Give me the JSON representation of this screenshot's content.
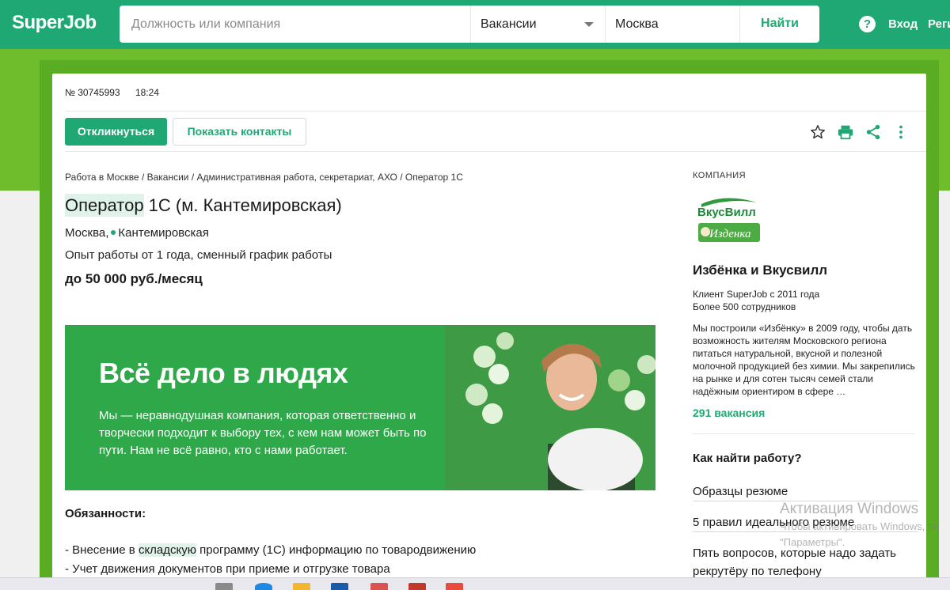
{
  "header": {
    "logo": "SuperJob",
    "search_placeholder": "Должность или компания",
    "type_select": "Вакансии",
    "city": "Москва",
    "find_button": "Найти",
    "help_icon": "question-circle-icon",
    "login": "Вход",
    "register": "Реги"
  },
  "vacancy": {
    "number": "№ 30745993",
    "time": "18:24",
    "apply_button": "Откликнуться",
    "contacts_button": "Показать контакты",
    "toolbar_icons": [
      "star-icon",
      "print-icon",
      "share-icon",
      "more-vertical-icon"
    ],
    "breadcrumbs": "Работа в Москве / Вакансии / Административная работа, секретариат, АХО / Оператор 1С",
    "title_highlight": "Оператор",
    "title_rest": " 1С (м. Кантемировская)",
    "city": "Москва,",
    "metro": "Кантемировская",
    "experience": "Опыт работы от 1 года, сменный график работы",
    "salary": "до 50 000 руб./месяц",
    "banner": {
      "title": "Всё дело в людях",
      "text": "Мы — неравнодушная компания, которая ответственно и творчески подходит к выбору тех, с кем нам может быть по пути. Нам не всё равно, кто с нами работает."
    },
    "duties_heading": "Обязанности:",
    "duty1_prefix": "- Внесение в ",
    "duty1_highlight": "складскую",
    "duty1_suffix": " программу (1С) информацию по товародвижению",
    "duty2": "- Учет движения документов при приеме и отгрузке товара"
  },
  "company": {
    "heading": "КОМПАНИЯ",
    "logo_text_top": "ВкусВилл",
    "logo_text_bottom": "Изденка",
    "name": "Избёнка и Вкусвилл",
    "client_since": "Клиент SuperJob с 2011 года",
    "employees": "Более 500 сотрудников",
    "description": "Мы построили «Избёнку» в 2009 году, чтобы дать возможность жителям Московского региона питаться натуральной, вкусной и полезной молочной продукцией без химии. Мы закрепились на рынке и для сотен тысяч семей стали надёжным ориентиром в сфере …",
    "vacancies": "291 вакансия"
  },
  "sidebar": {
    "how_heading": "Как найти работу?",
    "links": [
      "Образцы резюме",
      "5 правил идеального резюме",
      "Пять вопросов, которые надо задать",
      "рекрутёру по телефону"
    ]
  },
  "watermark": {
    "line1": "Активация Windows",
    "line2": "Чтобы активировать Windows, пе",
    "line3": "\"Параметры\"."
  },
  "colors": {
    "brand": "#1fa873",
    "page_green": "#6fbd2c",
    "banner_green": "#2fa84a"
  }
}
